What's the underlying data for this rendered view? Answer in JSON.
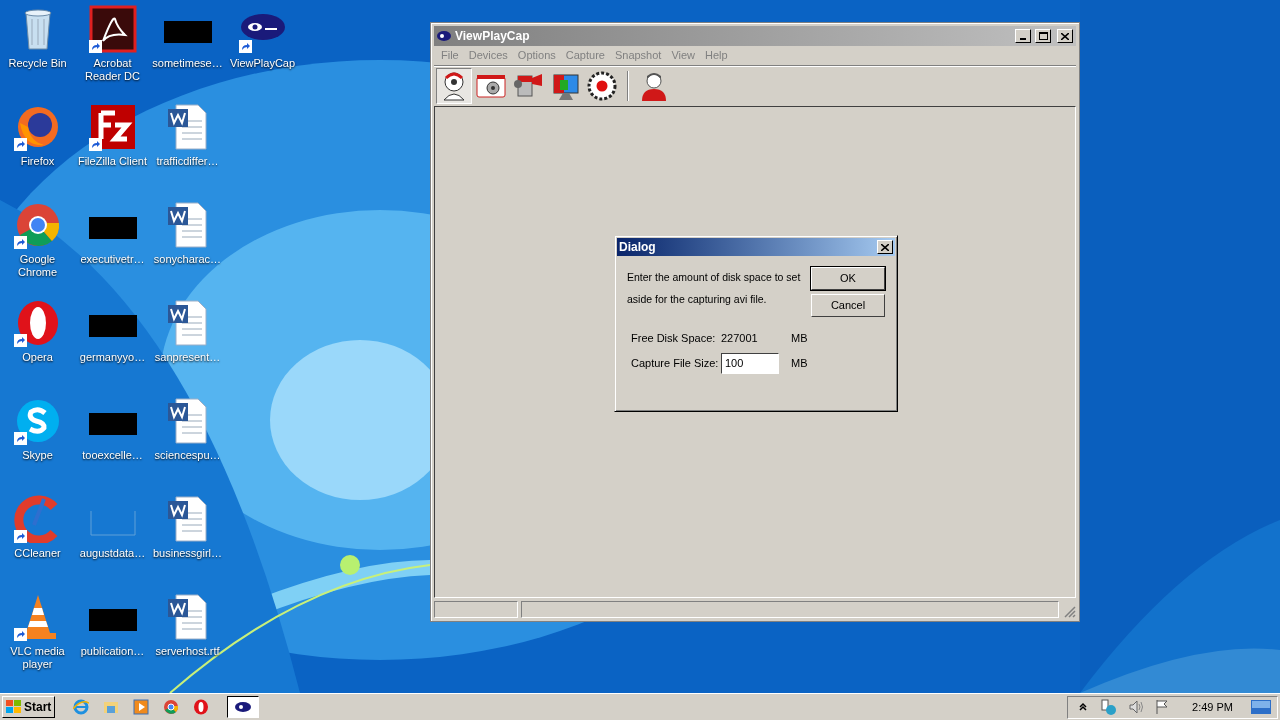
{
  "desktop_icons": [
    {
      "label": "Recycle Bin",
      "kind": "recycle",
      "shortcut": false
    },
    {
      "label": "Firefox",
      "kind": "firefox",
      "shortcut": true
    },
    {
      "label": "Google Chrome",
      "kind": "chrome",
      "shortcut": true
    },
    {
      "label": "Opera",
      "kind": "opera",
      "shortcut": true
    },
    {
      "label": "Skype",
      "kind": "skype",
      "shortcut": true
    },
    {
      "label": "CCleaner",
      "kind": "ccleaner",
      "shortcut": true
    },
    {
      "label": "VLC media player",
      "kind": "vlc",
      "shortcut": true
    },
    {
      "label": "Acrobat Reader DC",
      "kind": "acrobat",
      "shortcut": true
    },
    {
      "label": "FileZilla Client",
      "kind": "filezilla",
      "shortcut": true
    },
    {
      "label": "executivetr…",
      "kind": "redacted",
      "shortcut": false
    },
    {
      "label": "germanyyo…",
      "kind": "redacted",
      "shortcut": false
    },
    {
      "label": "tooexcelle…",
      "kind": "redacted",
      "shortcut": false
    },
    {
      "label": "augustdata…",
      "kind": "blank",
      "shortcut": false
    },
    {
      "label": "publication…",
      "kind": "redacted",
      "shortcut": false
    },
    {
      "label": "sometimese…",
      "kind": "redacted",
      "shortcut": false
    },
    {
      "label": "trafficdiffer…",
      "kind": "word",
      "shortcut": false
    },
    {
      "label": "sonycharac…",
      "kind": "word",
      "shortcut": false
    },
    {
      "label": "sanpresent…",
      "kind": "word",
      "shortcut": false
    },
    {
      "label": "sciencespu…",
      "kind": "word",
      "shortcut": false
    },
    {
      "label": "businessgirl…",
      "kind": "word",
      "shortcut": false
    },
    {
      "label": "serverhost.rtf",
      "kind": "word",
      "shortcut": false
    },
    {
      "label": "ViewPlayCap",
      "kind": "viewplaycap",
      "shortcut": true
    }
  ],
  "window": {
    "title": "ViewPlayCap",
    "menu": [
      "File",
      "Devices",
      "Options",
      "Capture",
      "Snapshot",
      "View",
      "Help"
    ],
    "toolbar": [
      {
        "kind": "webcam",
        "selected": true
      },
      {
        "kind": "camera",
        "selected": false
      },
      {
        "kind": "camcorder",
        "selected": false
      },
      {
        "kind": "monitor",
        "selected": false
      },
      {
        "kind": "record",
        "selected": false
      },
      {
        "kind": "user",
        "selected": false
      }
    ]
  },
  "dialog": {
    "title": "Dialog",
    "message": "Enter the amount of disk space to set aside for the capturing avi file.",
    "buttons": [
      "OK",
      "Cancel"
    ],
    "fields": [
      {
        "label": "Free Disk Space:",
        "kind": "readout",
        "value": "227001",
        "unit": "MB"
      },
      {
        "label": "Capture File Size:",
        "kind": "input",
        "value": "100",
        "unit": "MB"
      }
    ]
  },
  "taskbar": {
    "start": "Start",
    "quick_launch": [
      {
        "kind": "ie"
      },
      {
        "kind": "explorer"
      },
      {
        "kind": "media"
      },
      {
        "kind": "chrome"
      },
      {
        "kind": "opera"
      }
    ],
    "tasks": [
      {
        "kind": "viewplaycap",
        "selected": true
      }
    ],
    "tray": [
      {
        "kind": "chevron"
      },
      {
        "kind": "network"
      },
      {
        "kind": "volume"
      },
      {
        "kind": "flag"
      }
    ],
    "clock": "2:49 PM"
  }
}
